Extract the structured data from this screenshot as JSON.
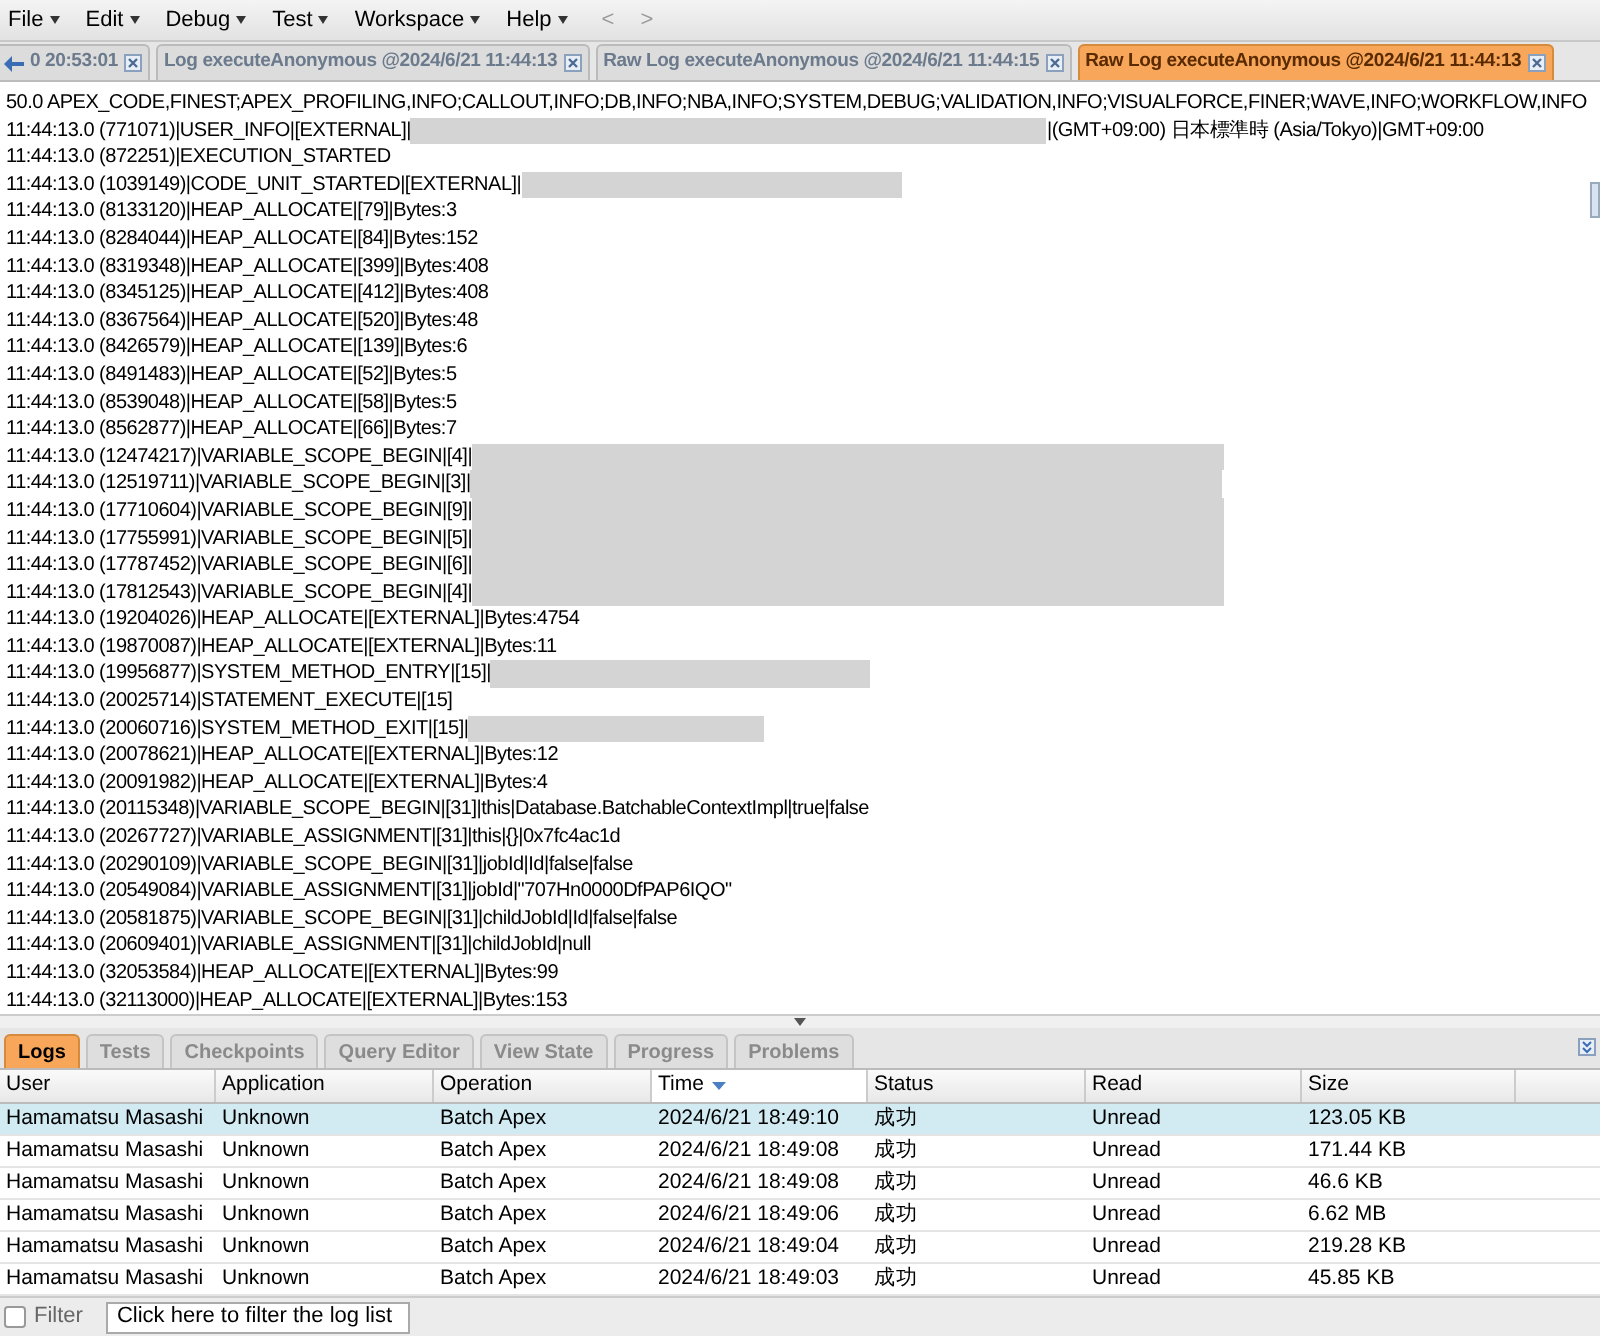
{
  "menu": [
    {
      "label": "File"
    },
    {
      "label": "Edit"
    },
    {
      "label": "Debug"
    },
    {
      "label": "Test"
    },
    {
      "label": "Workspace"
    },
    {
      "label": "Help"
    }
  ],
  "nav": {
    "back": "<",
    "forward": ">"
  },
  "editor_tabs": [
    {
      "label": "0 20:53:01",
      "selected": false,
      "kind": "partial"
    },
    {
      "label": "Log executeAnonymous @2024/6/21 11:44:13",
      "selected": false,
      "kind": "tab"
    },
    {
      "label": "Raw Log executeAnonymous @2024/6/21 11:44:15",
      "selected": false,
      "kind": "tab"
    },
    {
      "label": "Raw Log executeAnonymous @2024/6/21 11:44:13",
      "selected": true,
      "kind": "tab"
    }
  ],
  "log_lines": [
    {
      "text": "50.0 APEX_CODE,FINEST;APEX_PROFILING,INFO;CALLOUT,INFO;DB,INFO;NBA,INFO;SYSTEM,DEBUG;VALIDATION,INFO;VISUALFORCE,FINER;WAVE,INFO;WORKFLOW,INFO"
    },
    {
      "text": "11:44:13.0 (771071)|USER_INFO|[EXTERNAL]|",
      "kind": "redacted-long",
      "after": "|(GMT+09:00) 日本標準時 (Asia/Tokyo)|GMT+09:00"
    },
    {
      "text": "11:44:13.0 (872251)|EXECUTION_STARTED"
    },
    {
      "text": "11:44:13.0 (1039149)|CODE_UNIT_STARTED|[EXTERNAL]|",
      "kind": "redacted-medium"
    },
    {
      "text": "11:44:13.0 (8133120)|HEAP_ALLOCATE|[79]|Bytes:3"
    },
    {
      "text": "11:44:13.0 (8284044)|HEAP_ALLOCATE|[84]|Bytes:152"
    },
    {
      "text": "11:44:13.0 (8319348)|HEAP_ALLOCATE|[399]|Bytes:408"
    },
    {
      "text": "11:44:13.0 (8345125)|HEAP_ALLOCATE|[412]|Bytes:408"
    },
    {
      "text": "11:44:13.0 (8367564)|HEAP_ALLOCATE|[520]|Bytes:48"
    },
    {
      "text": "11:44:13.0 (8426579)|HEAP_ALLOCATE|[139]|Bytes:6"
    },
    {
      "text": "11:44:13.0 (8491483)|HEAP_ALLOCATE|[52]|Bytes:5"
    },
    {
      "text": "11:44:13.0 (8539048)|HEAP_ALLOCATE|[58]|Bytes:5"
    },
    {
      "text": "11:44:13.0 (8562877)|HEAP_ALLOCATE|[66]|Bytes:7"
    },
    {
      "text": "11:44:13.0 (12474217)|VARIABLE_SCOPE_BEGIN|[4]|",
      "kind": "redacted-block"
    },
    {
      "text": "11:44:13.0 (12519711)|VARIABLE_SCOPE_BEGIN|[3]|",
      "kind": "redacted-block"
    },
    {
      "text": "11:44:13.0 (17710604)|VARIABLE_SCOPE_BEGIN|[9]|",
      "kind": "redacted-block"
    },
    {
      "text": "11:44:13.0 (17755991)|VARIABLE_SCOPE_BEGIN|[5]|",
      "kind": "redacted-block"
    },
    {
      "text": "11:44:13.0 (17787452)|VARIABLE_SCOPE_BEGIN|[6]|",
      "kind": "redacted-block"
    },
    {
      "text": "11:44:13.0 (17812543)|VARIABLE_SCOPE_BEGIN|[4]|",
      "kind": "redacted-block"
    },
    {
      "text": "11:44:13.0 (19204026)|HEAP_ALLOCATE|[EXTERNAL]|Bytes:4754"
    },
    {
      "text": "11:44:13.0 (19870087)|HEAP_ALLOCATE|[EXTERNAL]|Bytes:11"
    },
    {
      "text": "11:44:13.0 (19956877)|SYSTEM_METHOD_ENTRY|[15]|",
      "kind": "redacted-medium"
    },
    {
      "text": "11:44:13.0 (20025714)|STATEMENT_EXECUTE|[15]"
    },
    {
      "text": "11:44:13.0 (20060716)|SYSTEM_METHOD_EXIT|[15]|",
      "kind": "redacted-short"
    },
    {
      "text": "11:44:13.0 (20078621)|HEAP_ALLOCATE|[EXTERNAL]|Bytes:12"
    },
    {
      "text": "11:44:13.0 (20091982)|HEAP_ALLOCATE|[EXTERNAL]|Bytes:4"
    },
    {
      "text": "11:44:13.0 (20115348)|VARIABLE_SCOPE_BEGIN|[31]|this|Database.BatchableContextImpl|true|false"
    },
    {
      "text": "11:44:13.0 (20267727)|VARIABLE_ASSIGNMENT|[31]|this|{}|0x7fc4ac1d"
    },
    {
      "text": "11:44:13.0 (20290109)|VARIABLE_SCOPE_BEGIN|[31]|jobId|Id|false|false"
    },
    {
      "text": "11:44:13.0 (20549084)|VARIABLE_ASSIGNMENT|[31]|jobId|\"707Hn0000DfPAP6IQO\""
    },
    {
      "text": "11:44:13.0 (20581875)|VARIABLE_SCOPE_BEGIN|[31]|childJobId|Id|false|false"
    },
    {
      "text": "11:44:13.0 (20609401)|VARIABLE_ASSIGNMENT|[31]|childJobId|null"
    },
    {
      "text": "11:44:13.0 (32053584)|HEAP_ALLOCATE|[EXTERNAL]|Bytes:99"
    },
    {
      "text": "11:44:13.0 (32113000)|HEAP_ALLOCATE|[EXTERNAL]|Bytes:153"
    }
  ],
  "bottom_tabs": [
    {
      "label": "Logs",
      "selected": true
    },
    {
      "label": "Tests",
      "selected": false
    },
    {
      "label": "Checkpoints",
      "selected": false
    },
    {
      "label": "Query Editor",
      "selected": false
    },
    {
      "label": "View State",
      "selected": false
    },
    {
      "label": "Progress",
      "selected": false
    },
    {
      "label": "Problems",
      "selected": false
    }
  ],
  "table": {
    "columns": [
      {
        "label": "User",
        "sorted": false
      },
      {
        "label": "Application",
        "sorted": false
      },
      {
        "label": "Operation",
        "sorted": false
      },
      {
        "label": "Time",
        "sorted": true
      },
      {
        "label": "Status",
        "sorted": false
      },
      {
        "label": "Read",
        "sorted": false
      },
      {
        "label": "Size",
        "sorted": false
      }
    ],
    "rows": [
      {
        "selected": true,
        "cells": [
          "Hamamatsu Masashi",
          "Unknown",
          "Batch Apex",
          "2024/6/21 18:49:10",
          "成功",
          "Unread",
          "123.05 KB"
        ]
      },
      {
        "selected": false,
        "cells": [
          "Hamamatsu Masashi",
          "Unknown",
          "Batch Apex",
          "2024/6/21 18:49:08",
          "成功",
          "Unread",
          "171.44 KB"
        ]
      },
      {
        "selected": false,
        "cells": [
          "Hamamatsu Masashi",
          "Unknown",
          "Batch Apex",
          "2024/6/21 18:49:08",
          "成功",
          "Unread",
          "46.6 KB"
        ]
      },
      {
        "selected": false,
        "cells": [
          "Hamamatsu Masashi",
          "Unknown",
          "Batch Apex",
          "2024/6/21 18:49:06",
          "成功",
          "Unread",
          "6.62 MB"
        ]
      },
      {
        "selected": false,
        "cells": [
          "Hamamatsu Masashi",
          "Unknown",
          "Batch Apex",
          "2024/6/21 18:49:04",
          "成功",
          "Unread",
          "219.28 KB"
        ]
      },
      {
        "selected": false,
        "cells": [
          "Hamamatsu Masashi",
          "Unknown",
          "Batch Apex",
          "2024/6/21 18:49:03",
          "成功",
          "Unread",
          "45.85 KB"
        ]
      }
    ]
  },
  "filter": {
    "label": "Filter",
    "checked": false,
    "placeholder": "Click here to filter the log list"
  }
}
